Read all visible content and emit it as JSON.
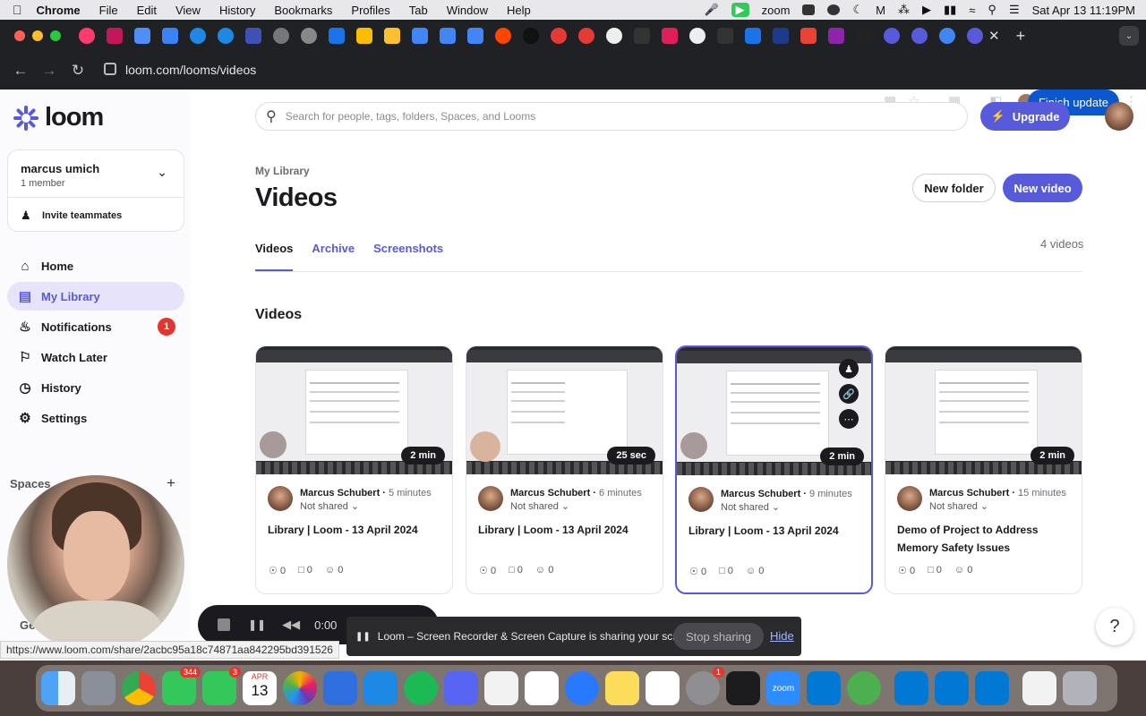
{
  "menubar": {
    "app": "Chrome",
    "items": [
      "File",
      "Edit",
      "View",
      "History",
      "Bookmarks",
      "Profiles",
      "Tab",
      "Window",
      "Help"
    ],
    "right_app": "zoom",
    "datetime": "Sat Apr 13  11:19PM"
  },
  "browser": {
    "url": "loom.com/looms/videos",
    "finish_update": "Finish update",
    "status_url": "https://www.loom.com/share/2acbc95a18c74871aa842295bd391526"
  },
  "sidebar": {
    "logo": "loom",
    "workspace": {
      "name": "marcus umich",
      "members": "1 member",
      "invite": "Invite teammates"
    },
    "items": [
      {
        "label": "Home",
        "icon": "home-icon"
      },
      {
        "label": "My Library",
        "icon": "library-icon"
      },
      {
        "label": "Notifications",
        "icon": "bell-icon",
        "badge": "1"
      },
      {
        "label": "Watch Later",
        "icon": "bookmark-icon"
      },
      {
        "label": "History",
        "icon": "history-icon"
      },
      {
        "label": "Settings",
        "icon": "gear-icon"
      }
    ],
    "spaces_label": "Spaces",
    "cam_label": "Ge"
  },
  "search": {
    "placeholder": "Search for people, tags, folders, Spaces, and Looms"
  },
  "header": {
    "upgrade": "Upgrade",
    "breadcrumb": "My Library",
    "title": "Videos",
    "new_folder": "New folder",
    "new_video": "New video"
  },
  "tabs": [
    "Videos",
    "Archive",
    "Screenshots"
  ],
  "video_count": "4 videos",
  "section_title": "Videos",
  "videos": [
    {
      "author": "Marcus Schubert",
      "time": "5 minutes",
      "sharing": "Not shared",
      "title": "Library | Loom - 13 April 2024",
      "duration": "2 min",
      "views": "0",
      "comments": "0",
      "reactions": "0"
    },
    {
      "author": "Marcus Schubert",
      "time": "6 minutes",
      "sharing": "Not shared",
      "title": "Library | Loom - 13 April 2024",
      "duration": "25 sec",
      "views": "0",
      "comments": "0",
      "reactions": "0"
    },
    {
      "author": "Marcus Schubert",
      "time": "9 minutes",
      "sharing": "Not shared",
      "title": "Library | Loom - 13 April 2024",
      "duration": "2 min",
      "views": "0",
      "comments": "0",
      "reactions": "0"
    },
    {
      "author": "Marcus Schubert",
      "time": "15 minutes",
      "sharing": "Not shared",
      "title": "Demo of Project to Address Memory Safety Issues",
      "duration": "2 min",
      "views": "0",
      "comments": "0",
      "reactions": "0"
    }
  ],
  "recorder": {
    "time": "0:00"
  },
  "share_bar": {
    "message": "Loom – Screen Recorder & Screen Capture is sharing your screen.",
    "stop": "Stop sharing",
    "hide": "Hide"
  },
  "help": "?",
  "dock_badges": {
    "messages": "344",
    "facetime": "3",
    "calendar_month": "APR",
    "calendar_day": "13",
    "settings": "1",
    "zoom": "zoom"
  },
  "colors": {
    "accent": "#565adb",
    "badge": "#e0362e",
    "chrome_bg": "#202124"
  }
}
